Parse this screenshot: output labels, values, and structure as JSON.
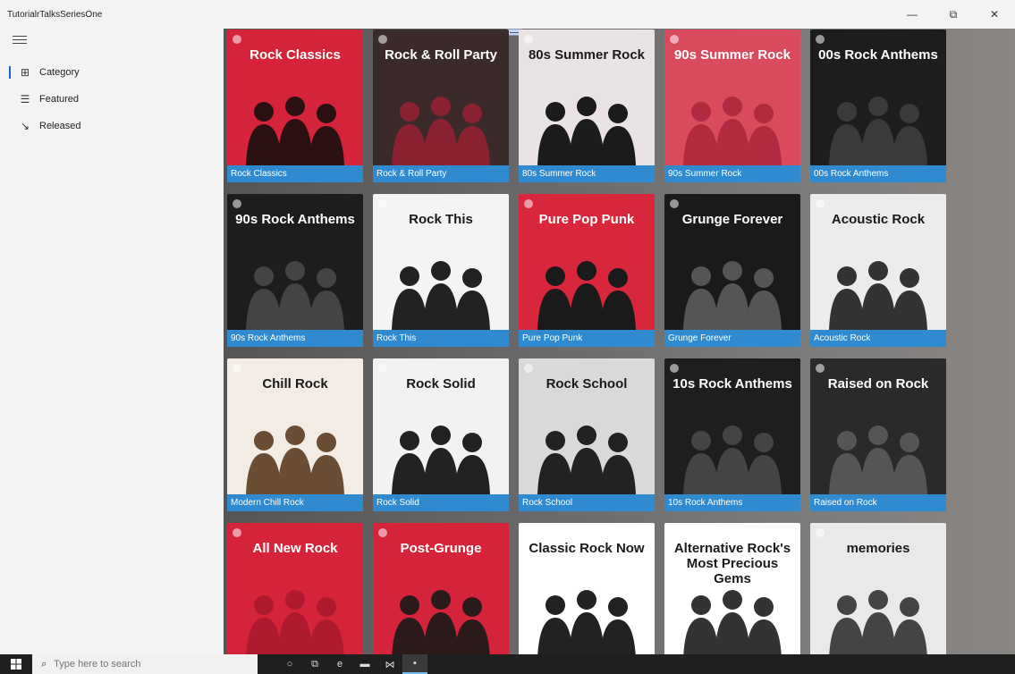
{
  "window": {
    "title": "TutorialrTalksSeriesOne",
    "minimize_label": "—",
    "restore_label": "⧉",
    "close_label": "✕"
  },
  "sidebar": {
    "menu_icon": "hamburger-icon",
    "items": [
      {
        "label": "Category",
        "icon": "category-icon",
        "glyph": "⊞",
        "selected": true
      },
      {
        "label": "Featured",
        "icon": "featured-icon",
        "glyph": "☰",
        "selected": false
      },
      {
        "label": "Released",
        "icon": "released-icon",
        "glyph": "↘",
        "selected": false
      }
    ]
  },
  "playlists": [
    {
      "name": "Rock Classics",
      "headline": "Rock Classics",
      "bg": "#d5243a",
      "fg": "#2a1010"
    },
    {
      "name": "Rock & Roll Party",
      "headline": "Rock & Roll Party",
      "bg": "#3b2a2a",
      "fg": "#8a2030"
    },
    {
      "name": "80s Summer Rock",
      "headline": "80s Summer Rock",
      "bg": "#e9e3e3",
      "fg": "#1b1b1b"
    },
    {
      "name": "90s Summer Rock",
      "headline": "90s Summer Rock",
      "bg": "#d94a5c",
      "fg": "#b22a40"
    },
    {
      "name": "00s Rock Anthems",
      "headline": "00s Rock Anthems",
      "bg": "#1d1d1d",
      "fg": "#3a3a3a"
    },
    {
      "name": "90s Rock Anthems",
      "headline": "90s Rock Anthems",
      "bg": "#1d1d1d",
      "fg": "#444"
    },
    {
      "name": "Rock This",
      "headline": "Rock This",
      "bg": "#f4f4f4",
      "fg": "#222"
    },
    {
      "name": "Pure Pop Punk",
      "headline": "Pure Pop Punk",
      "bg": "#d8263a",
      "fg": "#1a1a1a"
    },
    {
      "name": "Grunge Forever",
      "headline": "Grunge Forever",
      "bg": "#1a1a1a",
      "fg": "#555"
    },
    {
      "name": "Acoustic Rock",
      "headline": "Acoustic Rock",
      "bg": "#ececec",
      "fg": "#333"
    },
    {
      "name": "Modern Chill Rock",
      "headline": "Chill Rock",
      "bg": "#f3ece4",
      "fg": "#6a4d33"
    },
    {
      "name": "Rock Solid",
      "headline": "Rock Solid",
      "bg": "#f2f2f2",
      "fg": "#222"
    },
    {
      "name": "Rock School",
      "headline": "Rock School",
      "bg": "#d9d9d9",
      "fg": "#222"
    },
    {
      "name": "10s Rock Anthems",
      "headline": "10s Rock Anthems",
      "bg": "#1e1e1e",
      "fg": "#444"
    },
    {
      "name": "Raised on Rock",
      "headline": "Raised on Rock",
      "bg": "#2a2a2a",
      "fg": "#555"
    },
    {
      "name": "All New Rock",
      "headline": "All New Rock",
      "bg": "#d5243a",
      "fg": "#b01a2e"
    },
    {
      "name": "Post-Grunge",
      "headline": "Post-Grunge",
      "bg": "#d5243a",
      "fg": "#2a1a1a"
    },
    {
      "name": "Classic Rock Now",
      "headline": "Classic Rock Now",
      "bg": "#ffffff",
      "fg": "#222"
    },
    {
      "name": "Alternative Rock's Most Precious Gems",
      "headline": "Alternative Rock's Most Precious Gems",
      "bg": "#ffffff",
      "fg": "#333"
    },
    {
      "name": "memories",
      "headline": "memories",
      "bg": "#e9e9e9",
      "fg": "#444"
    }
  ],
  "taskbar": {
    "start_icon": "windows-start-icon",
    "search_placeholder": "Type here to search",
    "search_glyph": "⌕",
    "apps": [
      {
        "icon": "cortana-icon",
        "glyph": "○"
      },
      {
        "icon": "task-view-icon",
        "glyph": "⧉"
      },
      {
        "icon": "edge-icon",
        "glyph": "e"
      },
      {
        "icon": "file-explorer-icon",
        "glyph": "▬"
      },
      {
        "icon": "visual-studio-icon",
        "glyph": "⋈"
      },
      {
        "icon": "running-app-icon",
        "glyph": "▪",
        "active": true
      }
    ]
  }
}
